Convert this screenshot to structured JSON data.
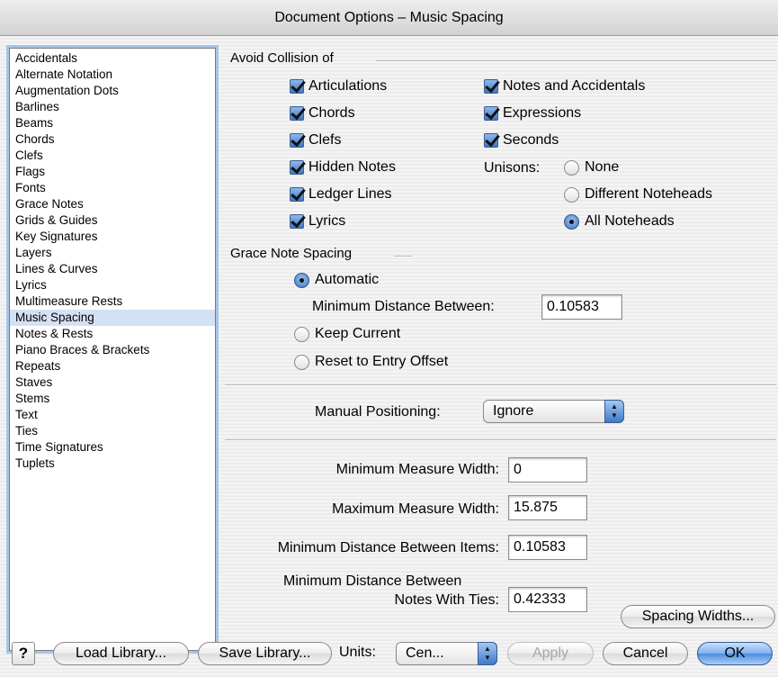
{
  "window": {
    "title": "Document Options – Music Spacing"
  },
  "categories": [
    "Accidentals",
    "Alternate Notation",
    "Augmentation Dots",
    "Barlines",
    "Beams",
    "Chords",
    "Clefs",
    "Flags",
    "Fonts",
    "Grace Notes",
    "Grids & Guides",
    "Key Signatures",
    "Layers",
    "Lines & Curves",
    "Lyrics",
    "Multimeasure Rests",
    "Music Spacing",
    "Notes & Rests",
    "Piano Braces & Brackets",
    "Repeats",
    "Staves",
    "Stems",
    "Text",
    "Ties",
    "Time Signatures",
    "Tuplets"
  ],
  "selected_category": "Music Spacing",
  "avoid_collision": {
    "heading": "Avoid Collision of",
    "left_options": [
      {
        "label": "Articulations",
        "checked": true
      },
      {
        "label": "Chords",
        "checked": true
      },
      {
        "label": "Clefs",
        "checked": true
      },
      {
        "label": "Hidden Notes",
        "checked": true
      },
      {
        "label": "Ledger Lines",
        "checked": true
      },
      {
        "label": "Lyrics",
        "checked": true
      }
    ],
    "right_options": [
      {
        "label": "Notes and Accidentals",
        "checked": true
      },
      {
        "label": "Expressions",
        "checked": true
      },
      {
        "label": "Seconds",
        "checked": true
      }
    ],
    "unisons": {
      "label": "Unisons:",
      "options": [
        "None",
        "Different Noteheads",
        "All Noteheads"
      ],
      "selected": "All Noteheads"
    }
  },
  "grace_note_spacing": {
    "heading": "Grace Note Spacing",
    "automatic_label": "Automatic",
    "min_distance_label": "Minimum Distance Between:",
    "min_distance_value": "0.10583",
    "keep_current_label": "Keep Current",
    "reset_label": "Reset to Entry Offset",
    "selected": "Automatic"
  },
  "manual_positioning": {
    "label": "Manual Positioning:",
    "value": "Ignore"
  },
  "measure": {
    "min_width_label": "Minimum Measure Width:",
    "min_width_value": "0",
    "max_width_label": "Maximum Measure Width:",
    "max_width_value": "15.875",
    "min_items_label": "Minimum Distance Between Items:",
    "min_items_value": "0.10583",
    "ties_label_line1": "Minimum Distance Between",
    "ties_label_line2": "Notes With Ties:",
    "ties_value": "0.42333"
  },
  "buttons": {
    "spacing_widths": "Spacing Widths...",
    "help": "?",
    "load_library": "Load Library...",
    "save_library": "Save Library...",
    "units_label": "Units:",
    "units_value": "Cen...",
    "apply": "Apply",
    "cancel": "Cancel",
    "ok": "OK"
  }
}
